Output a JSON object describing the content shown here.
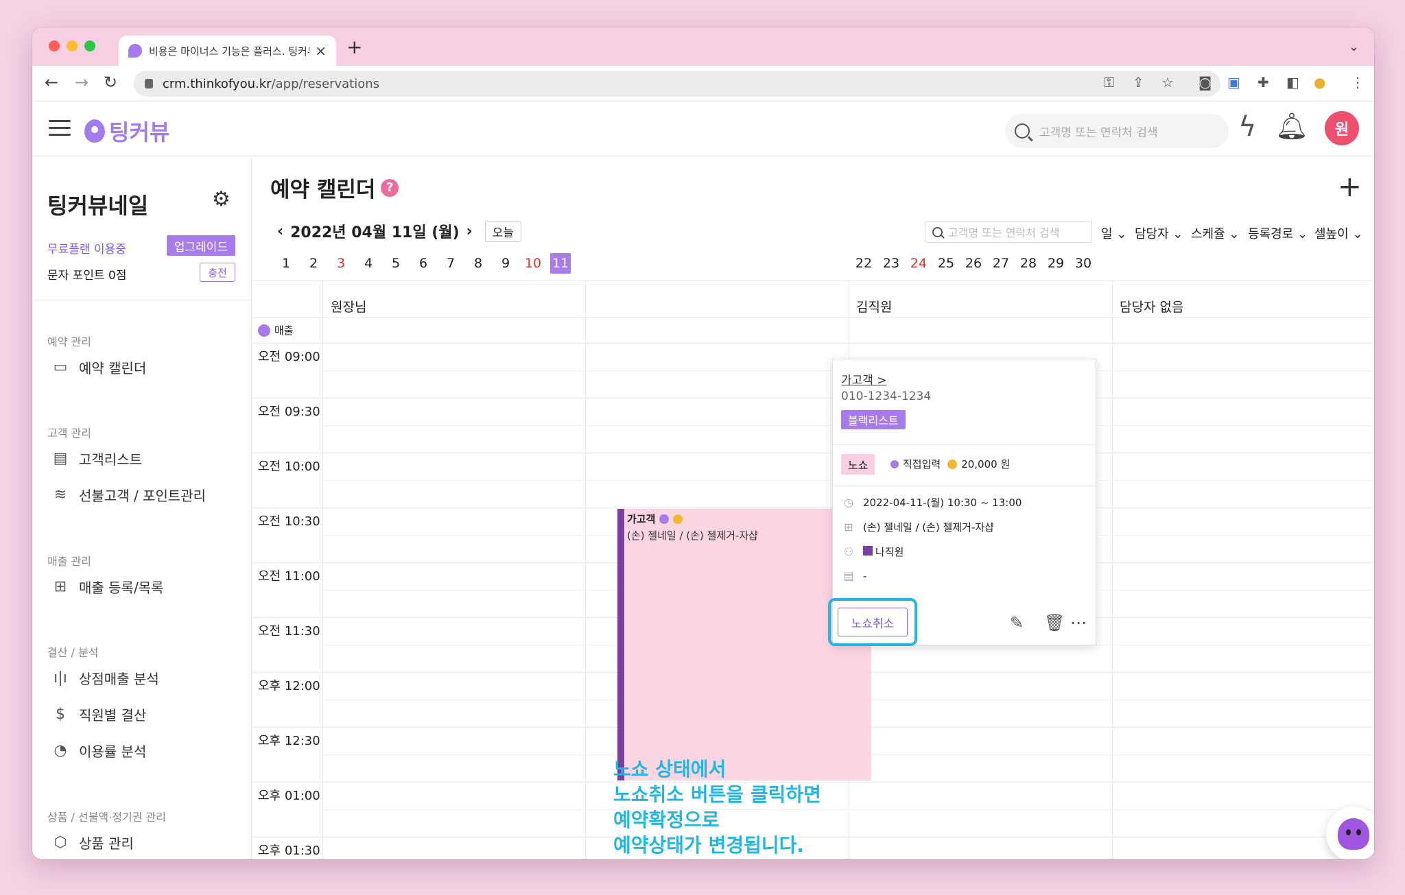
{
  "browser": {
    "tab_title": "비용은 마이너스 기능은 플러스. 팅커뷰",
    "url_host": "crm.thinkofyou.kr",
    "url_path": "/app/reservations"
  },
  "header": {
    "logo_text": "팅커뷰",
    "search_placeholder": "고객명 또는 연락처 검색",
    "avatar_text": "원"
  },
  "sidebar": {
    "shop_name": "팅커뷰네일",
    "plan_text": "무료플랜 이용중",
    "upgrade_label": "업그레이드",
    "points_text": "문자 포인트 0점",
    "charge_label": "충전",
    "sections": [
      {
        "title": "예약 관리",
        "items": [
          {
            "label": "예약 캘린더",
            "icon": "calendar-icon"
          }
        ]
      },
      {
        "title": "고객 관리",
        "items": [
          {
            "label": "고객리스트",
            "icon": "document-icon"
          },
          {
            "label": "선불고객 / 포인트관리",
            "icon": "database-icon"
          }
        ]
      },
      {
        "title": "매출 관리",
        "items": [
          {
            "label": "매출 등록/목록",
            "icon": "file-plus-icon"
          }
        ]
      },
      {
        "title": "결산 / 분석",
        "items": [
          {
            "label": "상점매출 분석",
            "icon": "bar-chart-icon"
          },
          {
            "label": "직원별 결산",
            "icon": "dollar-icon"
          },
          {
            "label": "이용률 분석",
            "icon": "pie-chart-icon"
          }
        ]
      },
      {
        "title": "상품 / 선불액·정기권 관리",
        "items": [
          {
            "label": "상품 관리",
            "icon": "box-icon"
          }
        ]
      }
    ]
  },
  "main": {
    "title": "예약 캘린더",
    "help": "?",
    "date_label": "2022년 04월 11일 (월)",
    "today_label": "오늘",
    "days_left": [
      "1",
      "2",
      "3",
      "4",
      "5",
      "6",
      "7",
      "8",
      "9",
      "10",
      "11"
    ],
    "days_right": [
      "22",
      "23",
      "24",
      "25",
      "26",
      "27",
      "28",
      "29",
      "30"
    ],
    "red_days": [
      "3",
      "10",
      "24"
    ],
    "selected_day": "11",
    "search_placeholder": "고객명 또는 연락처 검색",
    "filters": [
      "일",
      "담당자",
      "스케쥴",
      "등록경로",
      "셀높이"
    ],
    "columns": [
      "원장님",
      "김직원",
      "담당자 없음"
    ],
    "sales_label": "매출",
    "times": [
      "오전 09:00",
      "오전 09:30",
      "오전 10:00",
      "오전 10:30",
      "오전 11:00",
      "오전 11:30",
      "오후 12:00",
      "오후 12:30",
      "오후 01:00",
      "오후 01:30"
    ]
  },
  "event": {
    "title": "가고객",
    "services": "(손) 젤네일 / (손) 젤제거-자샵"
  },
  "popup": {
    "name": "가고객 >",
    "phone": "010-1234-1234",
    "blacklist": "블랙리스트",
    "status": "노쇼",
    "source": "직접입력",
    "price": "20,000 원",
    "datetime": "2022-04-11-(월) 10:30 ~ 13:00",
    "services": "(손) 젤네일 / (손) 젤제거-자샵",
    "staff": "나직원",
    "memo": "-",
    "cancel_noshow": "노쇼취소"
  },
  "annotation": [
    "노쇼 상태에서",
    "노쇼취소 버튼을 클릭하면",
    "예약확정으로",
    "예약상태가 변경됩니다."
  ],
  "colors": {
    "brand": "#a87bea",
    "accent_blue": "#22b6e3",
    "red": "#e53030",
    "event_bg": "#fbd5e0",
    "staff": "#7b3fa0"
  }
}
